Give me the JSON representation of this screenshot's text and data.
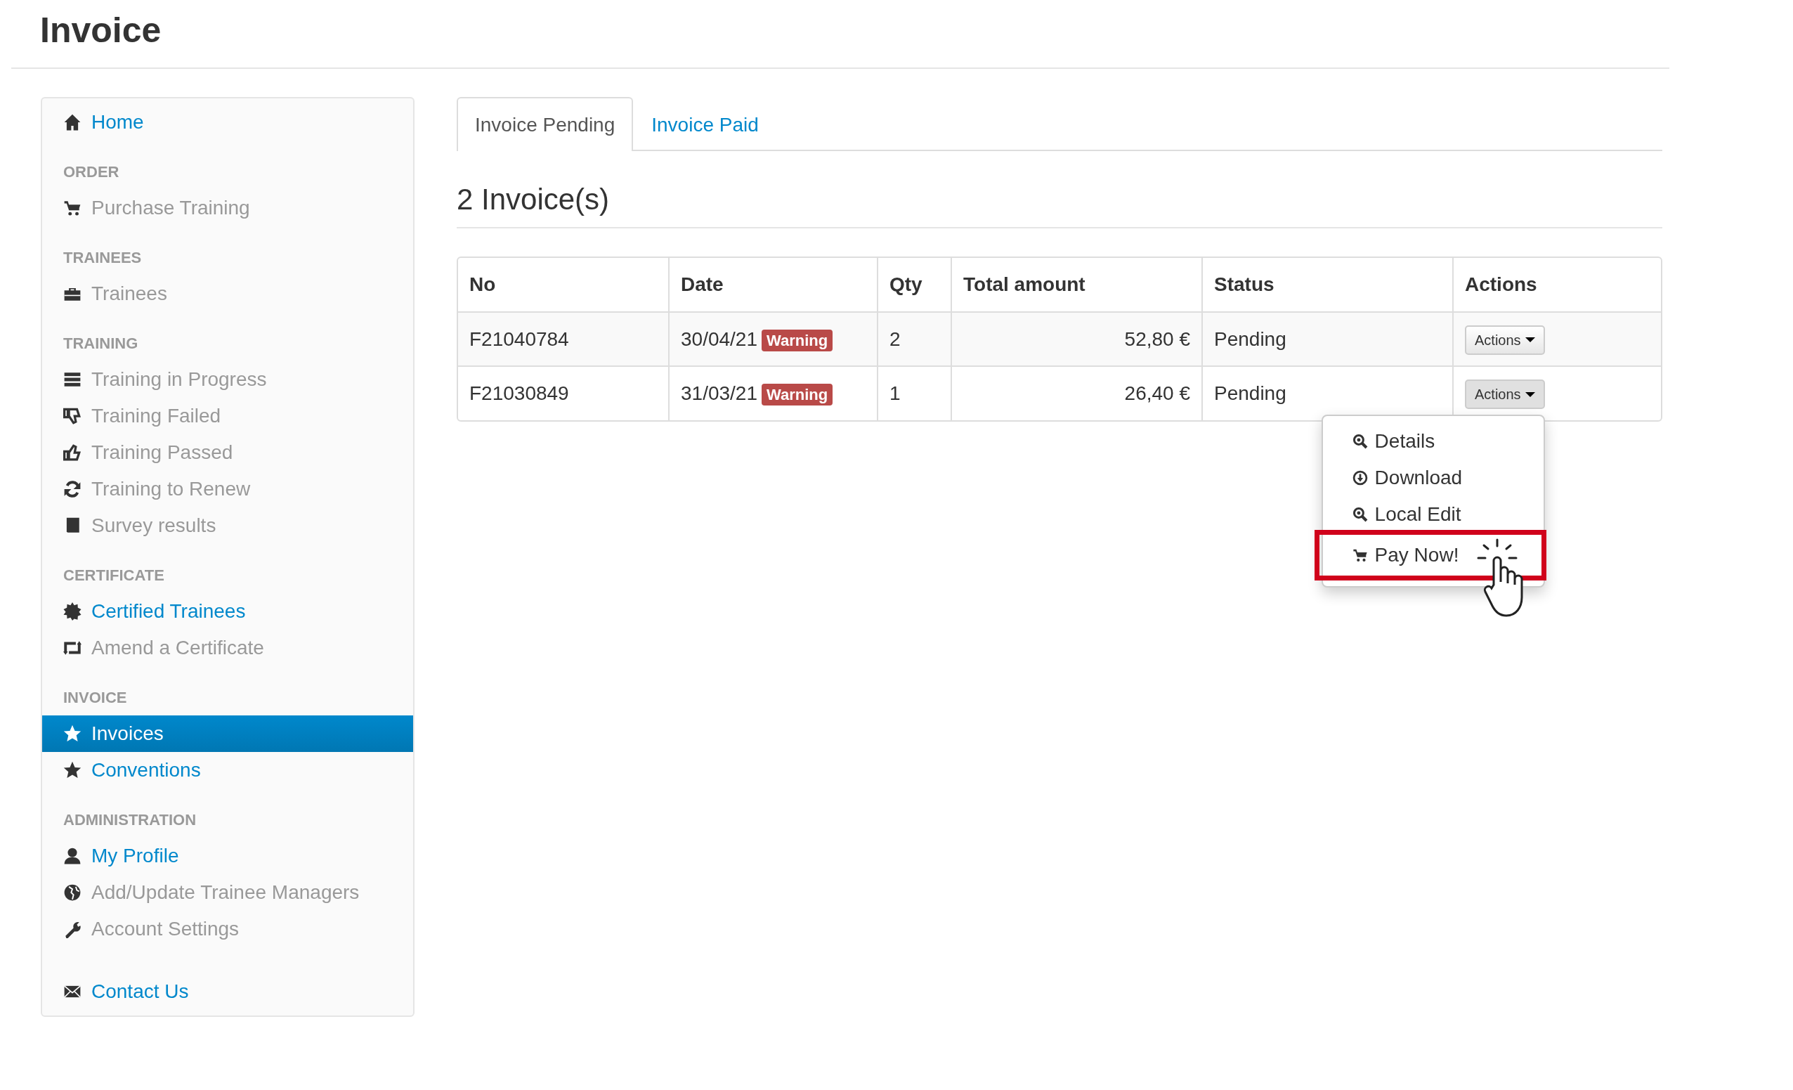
{
  "page_title": "Invoice",
  "sidebar": {
    "items": [
      {
        "kind": "link",
        "label": "Home",
        "disabled": false,
        "selected": false
      },
      {
        "kind": "header",
        "label": "ORDER"
      },
      {
        "kind": "link",
        "label": "Purchase Training",
        "disabled": true,
        "selected": false
      },
      {
        "kind": "header",
        "label": "TRAINEES"
      },
      {
        "kind": "link",
        "label": "Trainees",
        "disabled": true,
        "selected": false
      },
      {
        "kind": "header",
        "label": "TRAINING"
      },
      {
        "kind": "link",
        "label": "Training in Progress",
        "disabled": true,
        "selected": false
      },
      {
        "kind": "link",
        "label": "Training Failed",
        "disabled": true,
        "selected": false
      },
      {
        "kind": "link",
        "label": "Training Passed",
        "disabled": true,
        "selected": false
      },
      {
        "kind": "link",
        "label": "Training to Renew",
        "disabled": true,
        "selected": false
      },
      {
        "kind": "link",
        "label": "Survey results",
        "disabled": true,
        "selected": false
      },
      {
        "kind": "header",
        "label": "CERTIFICATE"
      },
      {
        "kind": "link",
        "label": "Certified Trainees",
        "disabled": false,
        "selected": false
      },
      {
        "kind": "link",
        "label": "Amend a Certificate",
        "disabled": true,
        "selected": false
      },
      {
        "kind": "header",
        "label": "INVOICE"
      },
      {
        "kind": "link",
        "label": "Invoices",
        "disabled": false,
        "selected": true
      },
      {
        "kind": "link",
        "label": "Conventions",
        "disabled": false,
        "selected": false
      },
      {
        "kind": "header",
        "label": "ADMINISTRATION"
      },
      {
        "kind": "link",
        "label": "My Profile",
        "disabled": false,
        "selected": false
      },
      {
        "kind": "link",
        "label": "Add/Update Trainee Managers",
        "disabled": true,
        "selected": false
      },
      {
        "kind": "link",
        "label": "Account Settings",
        "disabled": true,
        "selected": false
      },
      {
        "kind": "spacer"
      },
      {
        "kind": "link",
        "label": "Contact Us",
        "disabled": false,
        "selected": false
      }
    ]
  },
  "tabs": [
    {
      "label": "Invoice Pending",
      "selected": true
    },
    {
      "label": "Invoice Paid",
      "selected": false
    }
  ],
  "heading": "2 Invoice(s)",
  "table": {
    "columns": [
      "No",
      "Date",
      "Qty",
      "Total amount",
      "Status",
      "Actions"
    ],
    "rows": [
      {
        "no": "F21040784",
        "date": "30/04/21",
        "badge": "Warning",
        "qty": "2",
        "total": "52,80 €",
        "status": "Pending",
        "action": "Actions",
        "menu_open": false
      },
      {
        "no": "F21030849",
        "date": "31/03/21",
        "badge": "Warning",
        "qty": "1",
        "total": "26,40 €",
        "status": "Pending",
        "action": "Actions",
        "menu_open": true
      }
    ]
  },
  "actions_menu": {
    "items": [
      {
        "label": "Details",
        "highlighted": false
      },
      {
        "label": "Download",
        "highlighted": false
      },
      {
        "label": "Local Edit",
        "highlighted": false
      },
      {
        "label": "Pay Now!",
        "highlighted": true
      }
    ]
  }
}
